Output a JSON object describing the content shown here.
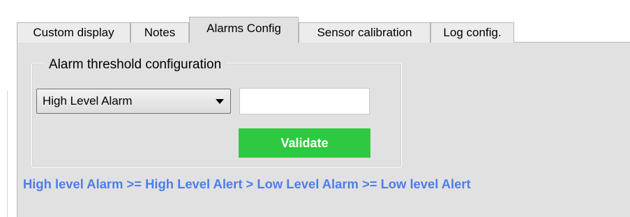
{
  "tabs": [
    {
      "label": "Custom display",
      "active": false
    },
    {
      "label": "Notes",
      "active": false
    },
    {
      "label": "Alarms Config",
      "active": true
    },
    {
      "label": "Sensor calibration",
      "active": false
    },
    {
      "label": "Log config.",
      "active": false
    }
  ],
  "group": {
    "title": "Alarm threshold configuration"
  },
  "alarm_select": {
    "selected": "High Level Alarm",
    "icon": "chevron-down-icon"
  },
  "threshold_input": {
    "value": "",
    "placeholder": ""
  },
  "validate_button": {
    "label": "Validate",
    "color": "#2ec940",
    "text_color": "#ffffff"
  },
  "hint": {
    "text": "High level Alarm >= High Level Alert > Low Level Alarm >= Low level Alert",
    "color": "#4d7ee8"
  },
  "colors": {
    "panel_background": "#e1e1e1",
    "page_background": "#ffffff"
  }
}
